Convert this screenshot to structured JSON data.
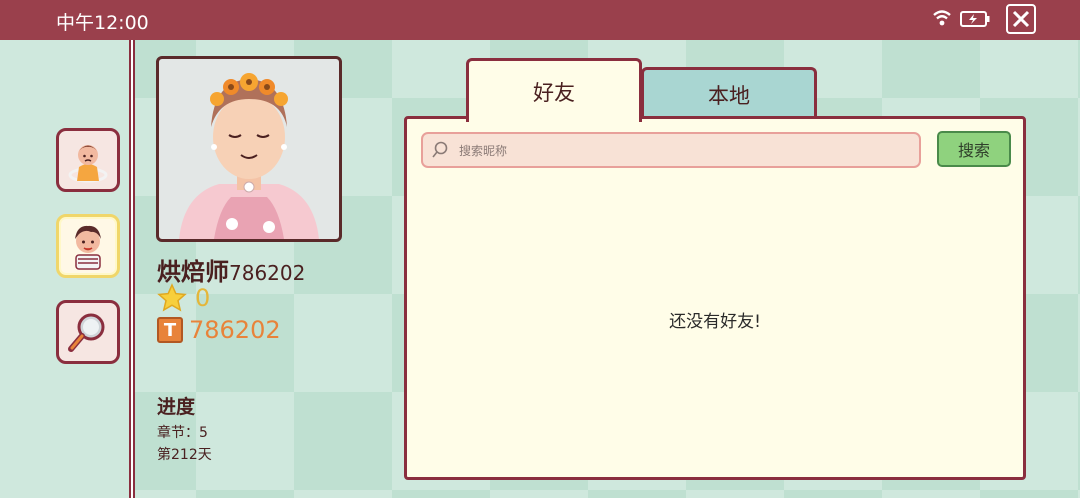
{
  "status_bar": {
    "time": "中午12:00",
    "icons": [
      "wifi-icon",
      "battery-icon",
      "close-icon"
    ]
  },
  "sidebar": {
    "buttons": [
      {
        "name": "characters-button",
        "icon": "kid-avatar-icon"
      },
      {
        "name": "profile-button",
        "icon": "boy-avatar-icon",
        "active": true
      },
      {
        "name": "search-button",
        "icon": "magnifier-icon"
      }
    ]
  },
  "profile": {
    "name": "烘焙师",
    "id": "786202",
    "stars": "0",
    "coins": "786202",
    "coin_icon_glyph": "T",
    "progress_title": "进度",
    "chapter": "章节：5",
    "day": "第212天"
  },
  "tabs": [
    {
      "label": "好友",
      "active": true
    },
    {
      "label": "本地",
      "active": false
    }
  ],
  "search": {
    "placeholder": "搜索昵称",
    "button_label": "搜索"
  },
  "friends": {
    "empty_message": "还没有好友!"
  },
  "colors": {
    "accent": "#9a404c",
    "border": "#8a2e3e",
    "panel_bg": "#fffde8",
    "tab_inactive": "#a9d6d2",
    "search_button": "#8fd27e",
    "star": "#e4b63a",
    "coin": "#e8833a"
  }
}
